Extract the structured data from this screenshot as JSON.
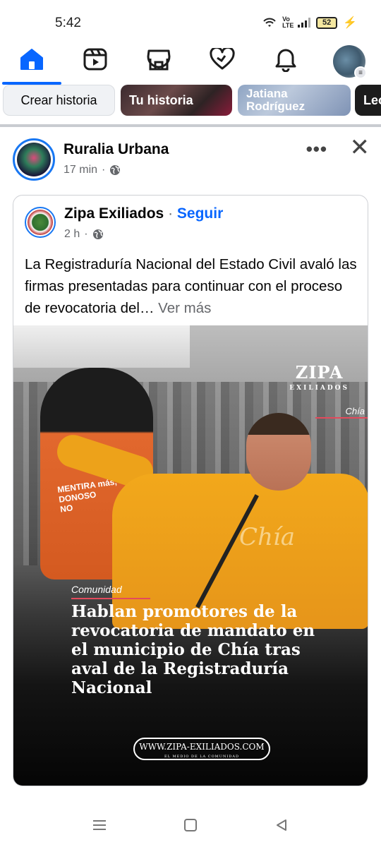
{
  "status_bar": {
    "time": "5:42",
    "network_label": "Vo\nLTE",
    "battery_level": "52"
  },
  "nav": {
    "tabs": [
      {
        "name": "home",
        "icon": "home-icon",
        "active": true
      },
      {
        "name": "video",
        "icon": "video-icon",
        "active": false
      },
      {
        "name": "marketplace",
        "icon": "marketplace-icon",
        "active": false
      },
      {
        "name": "dating",
        "icon": "heart-icon",
        "active": false
      },
      {
        "name": "notifications",
        "icon": "bell-icon",
        "active": false
      },
      {
        "name": "profile-menu",
        "icon": "menu-icon",
        "active": false
      }
    ],
    "accent_color": "#0866ff"
  },
  "stories": {
    "create_label": "Crear historia",
    "items": [
      {
        "label": "Tu historia"
      },
      {
        "label": "Jatiana\nRodríguez"
      },
      {
        "label": "Leo"
      }
    ]
  },
  "post": {
    "page_name": "Ruralia Urbana",
    "time": "17 min",
    "privacy_icon": "globe-icon",
    "shared": {
      "page_name": "Zipa Exiliados",
      "separator": "·",
      "follow_label": "Seguir",
      "time": "2 h",
      "text": "La Registraduría Nacional del Estado Civil avaló las firmas presentadas para continuar con el proceso de revocatoria del…",
      "see_more": "Ver más",
      "image": {
        "logo": "ZIPA",
        "logo_sub": "EXILIADOS",
        "location_tag": "Chía",
        "banner_text": "MENTIRA más,\nDONOSO\nNO",
        "sweater_text": "Chía",
        "category": "Comunidad",
        "headline": "Hablan promotores de la revocatoria de mandato en el municipio de Chía tras aval de la Registraduría Nacional",
        "url": "WWW.ZIPA-EXILIADOS.COM",
        "url_sub": "EL MEDIO DE LA COMUNIDAD"
      }
    }
  },
  "system_nav": {
    "buttons": [
      "recents-icon",
      "home-square-icon",
      "back-icon"
    ]
  }
}
